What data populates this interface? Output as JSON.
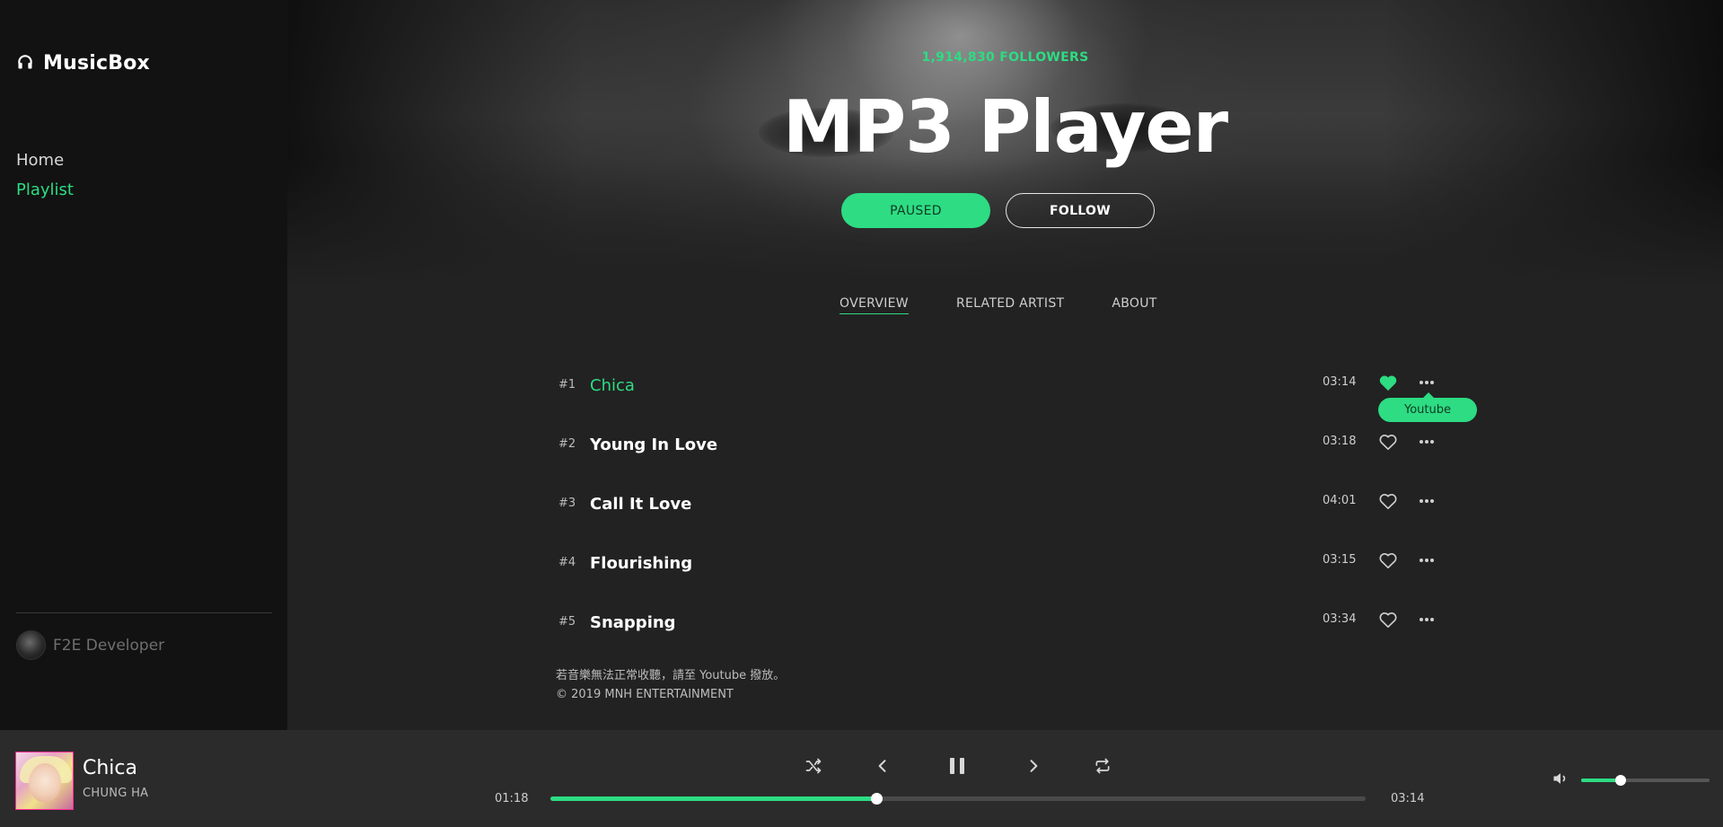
{
  "app": {
    "name": "MusicBox",
    "logo_icon": "headphones-icon"
  },
  "sidebar": {
    "items": [
      {
        "label": "Home",
        "active": false
      },
      {
        "label": "Playlist",
        "active": true
      }
    ],
    "developer": {
      "name": "F2E Developer"
    }
  },
  "hero": {
    "followers": "1,914,830 FOLLOWERS",
    "title": "MP3 Player",
    "paused_label": "PAUSED",
    "follow_label": "FOLLOW"
  },
  "tabs": [
    {
      "label": "OVERVIEW",
      "active": true
    },
    {
      "label": "RELATED ARTIST",
      "active": false
    },
    {
      "label": "ABOUT",
      "active": false
    }
  ],
  "tracks": [
    {
      "num": "#1",
      "title": "Chica",
      "duration": "03:14",
      "liked": true,
      "current": true
    },
    {
      "num": "#2",
      "title": "Young In Love",
      "duration": "03:18",
      "liked": false,
      "current": false
    },
    {
      "num": "#3",
      "title": "Call It Love",
      "duration": "04:01",
      "liked": false,
      "current": false
    },
    {
      "num": "#4",
      "title": "Flourishing",
      "duration": "03:15",
      "liked": false,
      "current": false
    },
    {
      "num": "#5",
      "title": "Snapping",
      "duration": "03:34",
      "liked": false,
      "current": false
    }
  ],
  "tooltip": {
    "label": "Youtube"
  },
  "notice": {
    "line1": "若音樂無法正常收聽，請至 Youtube 撥放。",
    "line2": "© 2019 MNH ENTERTAINMENT"
  },
  "player": {
    "song_title": "Chica",
    "artist": "CHUNG HA",
    "elapsed": "01:18",
    "total": "03:14",
    "progress": 0.4,
    "volume": 0.31,
    "controls": [
      "shuffle-icon",
      "previous-icon",
      "pause-icon",
      "next-icon",
      "repeat-icon",
      "volume-icon"
    ]
  },
  "colors": {
    "accent": "#2ddc83",
    "sidebar_bg": "#121212",
    "main_bg": "#222222",
    "player_bg": "#2b2b2b"
  }
}
